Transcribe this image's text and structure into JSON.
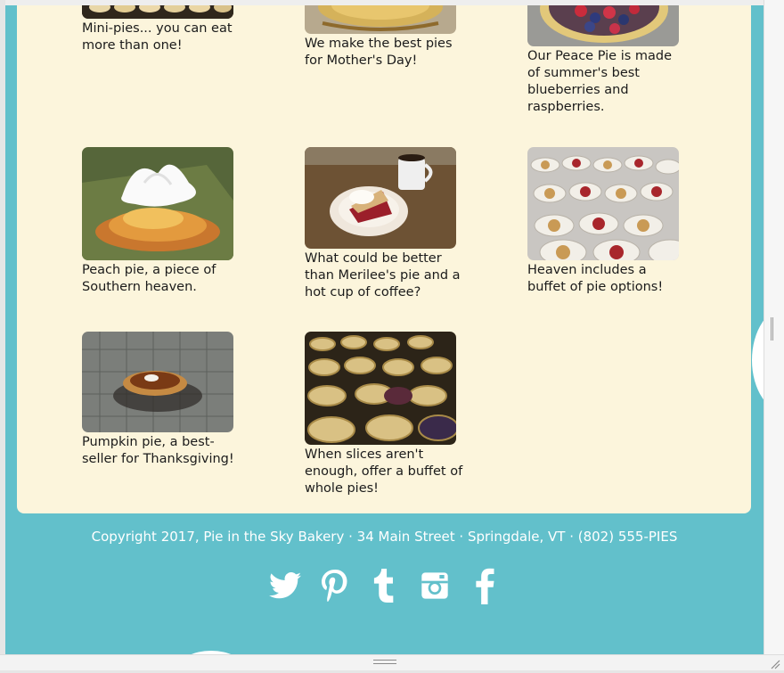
{
  "gallery": {
    "items": [
      {
        "caption": "Mini-pies... you can eat more than one!",
        "image": "mini-pies-photo"
      },
      {
        "caption": "We make the best pies for Mother's Day!",
        "image": "mothers-day-pie-photo"
      },
      {
        "caption": "Our Peace Pie is made of summer's best blueberries and raspberries.",
        "image": "peace-pie-photo"
      },
      {
        "caption": "Peach pie, a piece of Southern heaven.",
        "image": "peach-pie-photo"
      },
      {
        "caption": "What could be better than Merilee's pie and a hot cup of coffee?",
        "image": "pie-and-coffee-photo"
      },
      {
        "caption": "Heaven includes a buffet of pie options!",
        "image": "pie-slices-buffet-photo"
      },
      {
        "caption": "Pumpkin pie, a best-seller for Thanksgiving!",
        "image": "pumpkin-pie-photo"
      },
      {
        "caption": "When slices aren't enough, offer a buffet of whole pies!",
        "image": "whole-pies-buffet-photo"
      }
    ]
  },
  "footer": {
    "copyright": "Copyright 2017, Pie in the Sky Bakery · 34 Main Street · Springdale, VT · (802) 555-PIES",
    "social": [
      "twitter-icon",
      "pinterest-icon",
      "tumblr-icon",
      "instagram-icon",
      "facebook-icon"
    ]
  },
  "colors": {
    "background": "#62c0cb",
    "card": "#fcf5dc",
    "text": "#1b1b1b",
    "footer_text": "#ffffff"
  }
}
